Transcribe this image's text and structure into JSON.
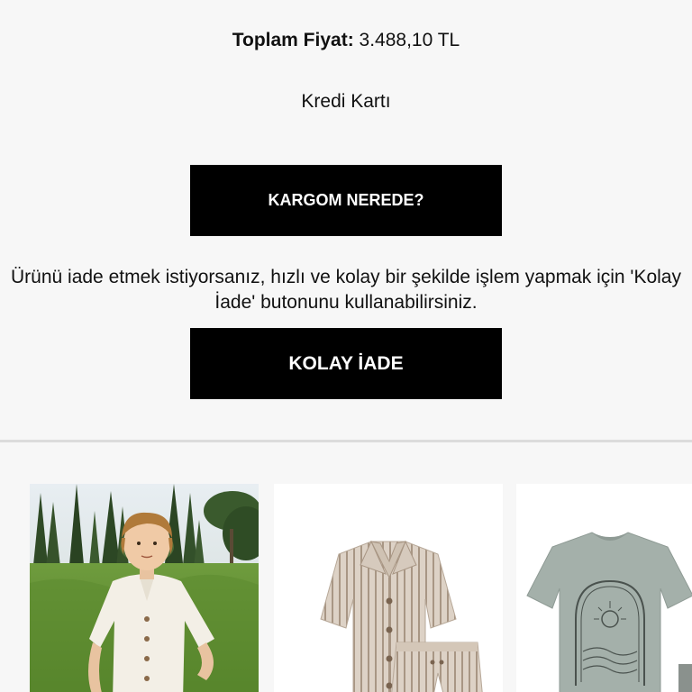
{
  "order": {
    "total_label": "Toplam Fiyat:",
    "total_value": "3.488,10 TL",
    "payment_method": "Kredi Kartı"
  },
  "actions": {
    "track_label": "KARGOM NEREDE?",
    "return_info": "Ürünü iade etmek istiyorsanız, hızlı ve kolay bir şekilde işlem yapmak için 'Kolay İade' butonunu kullanabilirsiniz.",
    "return_label": "KOLAY İADE"
  },
  "products": [
    {
      "icon": "child-model-photo"
    },
    {
      "icon": "striped-shirt-shorts-set-photo"
    },
    {
      "icon": "printed-tshirt-photo"
    }
  ],
  "colors": {
    "background": "#f7f7f7",
    "button": "#000000",
    "button_text": "#ffffff",
    "divider": "#dcdcdc"
  }
}
